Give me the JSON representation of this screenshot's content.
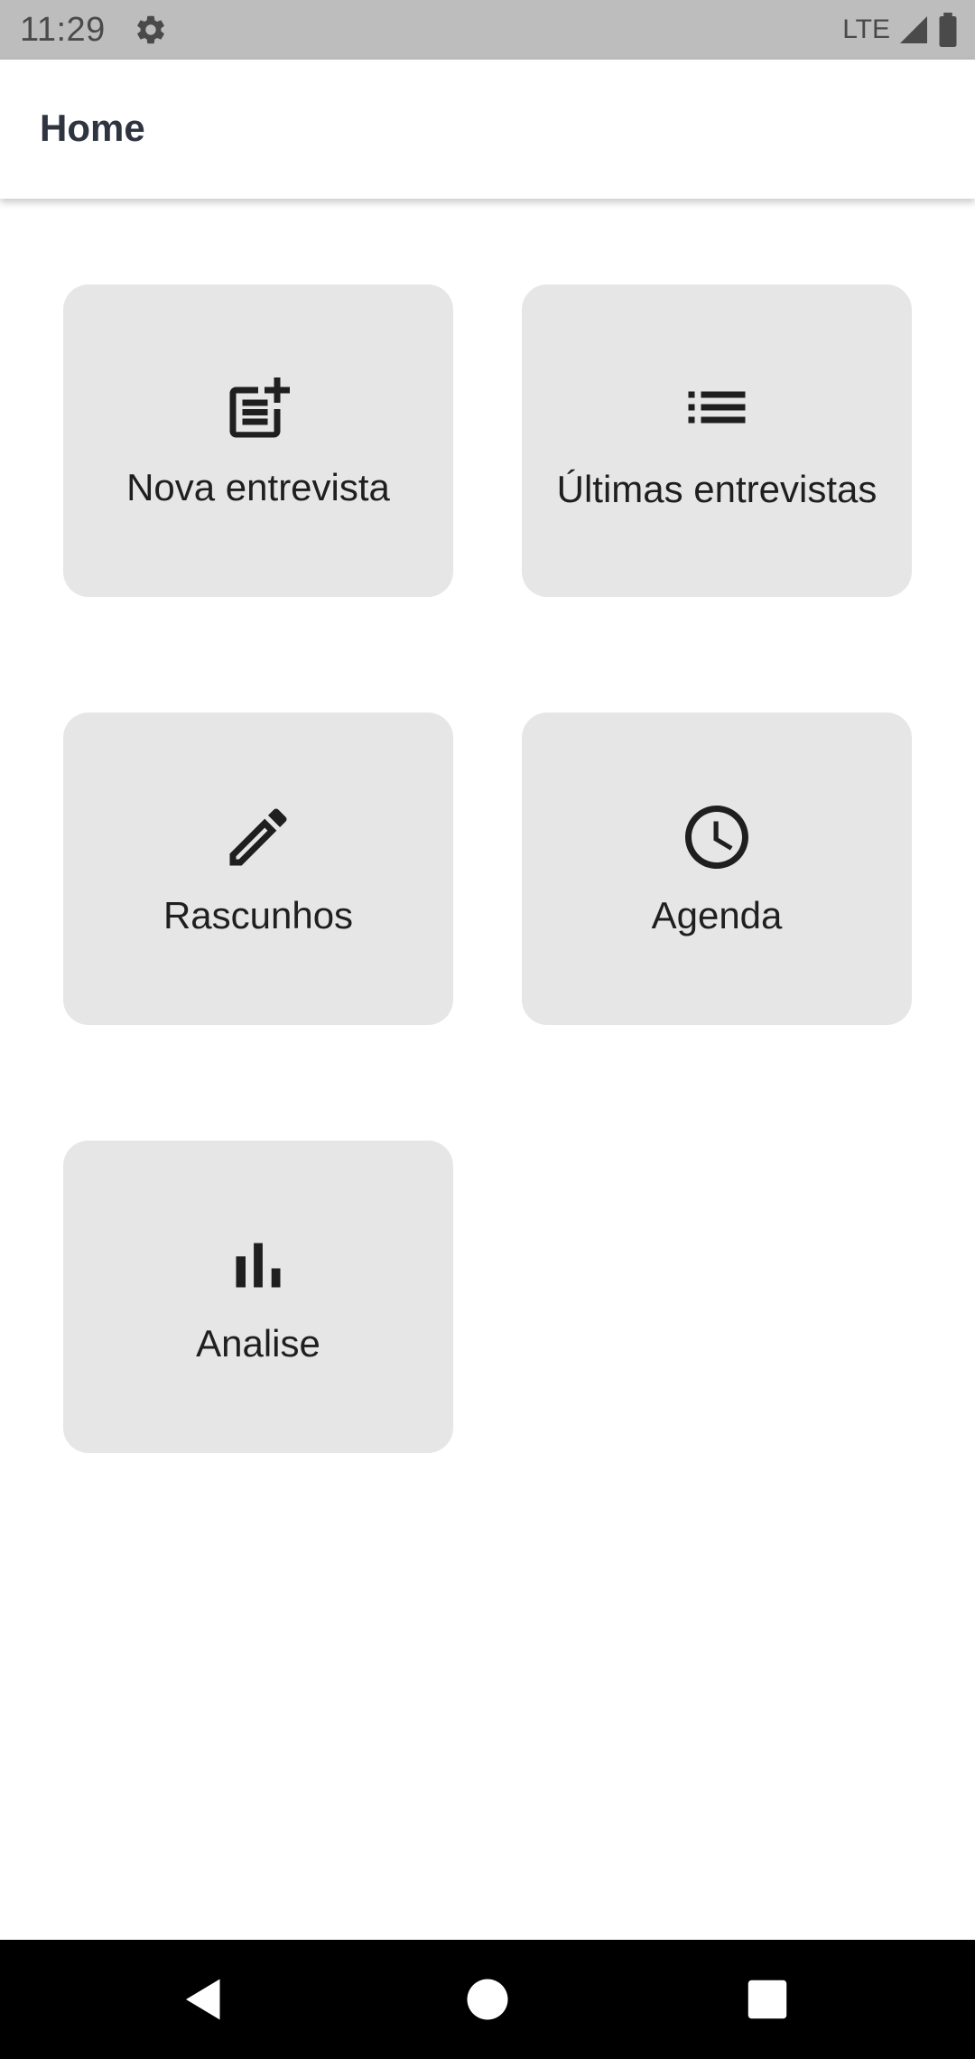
{
  "status_bar": {
    "time": "11:29",
    "network": "LTE",
    "icons": [
      "gear-icon",
      "signal-icon",
      "battery-icon"
    ]
  },
  "app_bar": {
    "title": "Home"
  },
  "tiles": [
    {
      "label": "Nova entrevista",
      "icon": "post-add-icon"
    },
    {
      "label": "Últimas entrevistas",
      "icon": "list-icon"
    },
    {
      "label": "Rascunhos",
      "icon": "pencil-icon"
    },
    {
      "label": "Agenda",
      "icon": "clock-icon"
    },
    {
      "label": "Analise",
      "icon": "bar-chart-icon"
    }
  ],
  "nav_bar": {
    "icons": [
      "back-icon",
      "home-icon",
      "recents-icon"
    ]
  },
  "colors": {
    "status_bar_bg": "#bdbdbd",
    "tile_bg": "#e6e6e6",
    "title_text": "#2f3441",
    "nav_bar_bg": "#000000"
  }
}
